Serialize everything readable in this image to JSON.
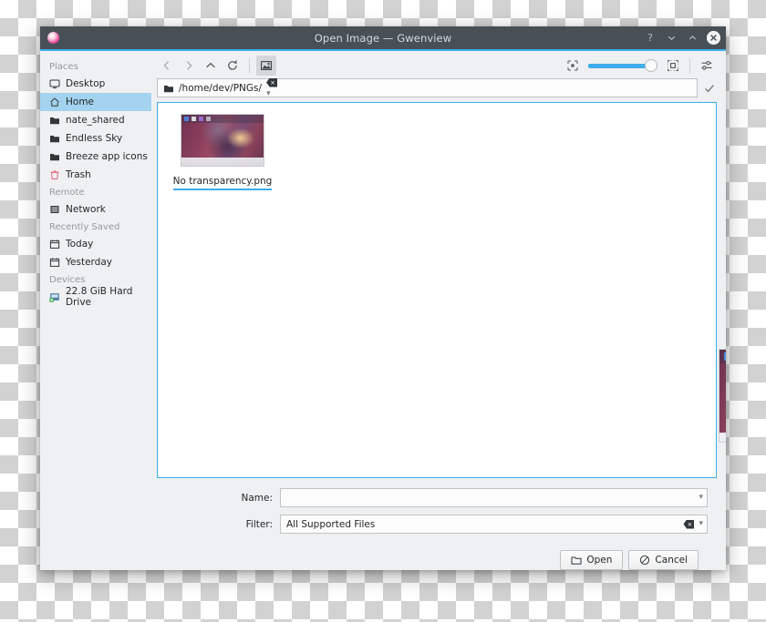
{
  "window": {
    "title": "Open Image — Gwenview",
    "app_icon": "gwenview-icon",
    "controls": [
      {
        "name": "help-button",
        "glyph": "?"
      },
      {
        "name": "minimize-button",
        "glyph": "⌄"
      },
      {
        "name": "maximize-button",
        "glyph": "⌃"
      },
      {
        "name": "close-button",
        "glyph": "✕"
      }
    ]
  },
  "sidebar": {
    "groups": [
      {
        "label": "Places",
        "items": [
          {
            "label": "Desktop",
            "icon": "monitor-icon",
            "selected": false
          },
          {
            "label": "Home",
            "icon": "home-icon",
            "selected": true
          },
          {
            "label": "nate_shared",
            "icon": "folder-icon",
            "selected": false
          },
          {
            "label": "Endless Sky",
            "icon": "folder-icon",
            "selected": false
          },
          {
            "label": "Breeze app icons",
            "icon": "folder-icon",
            "selected": false
          },
          {
            "label": "Trash",
            "icon": "trash-icon",
            "selected": false
          }
        ]
      },
      {
        "label": "Remote",
        "items": [
          {
            "label": "Network",
            "icon": "network-icon",
            "selected": false
          }
        ]
      },
      {
        "label": "Recently Saved",
        "items": [
          {
            "label": "Today",
            "icon": "calendar-icon",
            "selected": false
          },
          {
            "label": "Yesterday",
            "icon": "calendar-icon",
            "selected": false
          }
        ]
      },
      {
        "label": "Devices",
        "items": [
          {
            "label": "22.8 GiB Hard Drive",
            "icon": "hard-drive-icon",
            "selected": false
          }
        ]
      }
    ]
  },
  "toolbar": {
    "back": "back-icon",
    "forward": "forward-icon",
    "up": "up-icon",
    "reload": "reload-icon",
    "view_mode": "image-preview-icon",
    "zoom_small": "zoom-small-icon",
    "zoom_large": "zoom-large-icon",
    "zoom_value": 100,
    "options": "options-sliders-icon"
  },
  "path_bar": {
    "icon": "folder-icon",
    "path": "/home/dev/PNGs/",
    "clear_icon": "clear-icon",
    "dropdown_icon": "chevron-down-icon",
    "confirm_icon": "check-icon"
  },
  "file_view": {
    "items": [
      {
        "name": "No transparency.png",
        "selected": true,
        "thumbnail": "screenshot-thumbnail"
      }
    ]
  },
  "preview": {
    "name": "image-preview",
    "visible": true
  },
  "form": {
    "name_label": "Name:",
    "name_value": "",
    "name_placeholder": "",
    "filter_label": "Filter:",
    "filter_value": "All Supported Files",
    "filter_clear_icon": "clear-icon",
    "filter_dropdown_icon": "chevron-down-icon",
    "name_dropdown_icon": "chevron-down-icon"
  },
  "buttons": {
    "open": {
      "label": "Open",
      "icon": "folder-open-icon"
    },
    "cancel": {
      "label": "Cancel",
      "icon": "cancel-icon"
    }
  },
  "colors": {
    "titlebar": "#475057",
    "accent": "#3daee9",
    "selection": "#a3d3ee",
    "window_bg": "#eff0f1"
  }
}
